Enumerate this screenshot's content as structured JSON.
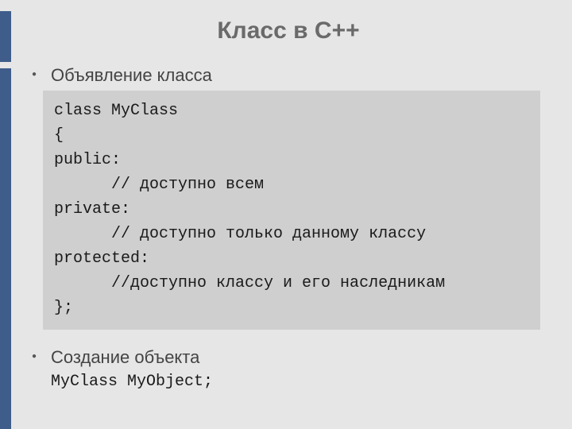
{
  "title": "Класс в С++",
  "bullets": {
    "declaration": "Объявление класса",
    "creation": "Создание объекта"
  },
  "code": {
    "declaration": "class MyClass\n{\npublic:\n      // доступно всем\nprivate:\n      // доступно только данному классу\nprotected:\n      //доступно классу и его наследникам\n};",
    "creation": "MyClass MyObject;"
  }
}
